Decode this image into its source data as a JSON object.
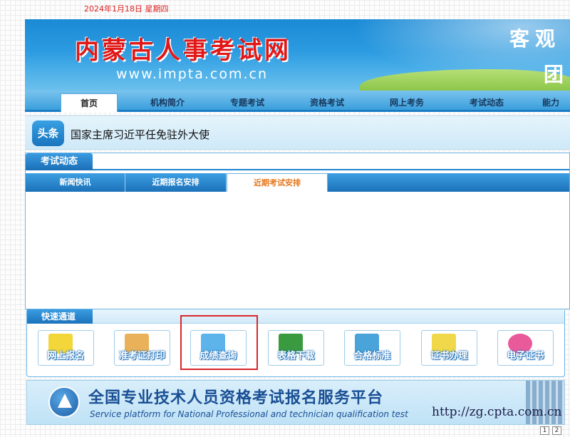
{
  "date": "2024年1月18日 星期四",
  "banner": {
    "title": "内蒙古人事考试网",
    "url": "www.impta.com.cn",
    "slogan_line1": "客观",
    "slogan_line2": "团"
  },
  "nav": {
    "items": [
      {
        "label": "首页",
        "active": true
      },
      {
        "label": "机构简介"
      },
      {
        "label": "专题考试"
      },
      {
        "label": "资格考试"
      },
      {
        "label": "网上考务"
      },
      {
        "label": "考试动态"
      },
      {
        "label": "能力"
      }
    ]
  },
  "headline": {
    "badge": "头条",
    "text": "国家主席习近平任免驻外大使"
  },
  "exam_news": {
    "title": "考试动态",
    "tabs": [
      {
        "label": "新闻快讯"
      },
      {
        "label": "近期报名安排"
      },
      {
        "label": "近期考试安排",
        "active": true
      }
    ]
  },
  "quick_access": {
    "title": "快速通道",
    "buttons": [
      {
        "label": "网上报名",
        "icon": "monitor-icon",
        "color": "#f2d63a"
      },
      {
        "label": "准考证打印",
        "icon": "printer-icon",
        "color": "#e9b25a"
      },
      {
        "label": "成绩查询",
        "icon": "magnifier-card-icon",
        "color": "#5db4ea"
      },
      {
        "label": "表格下载",
        "icon": "excel-icon",
        "color": "#3a9a3f"
      },
      {
        "label": "合格标准",
        "icon": "bar-chart-icon",
        "color": "#4aa3d9"
      },
      {
        "label": "证书办理",
        "icon": "certificate-icon",
        "color": "#f0d84a"
      },
      {
        "label": "电子证书",
        "icon": "e-certificate-icon",
        "color": "#e85a9a"
      }
    ]
  },
  "platform": {
    "title": "全国专业技术人员资格考试报名服务平台",
    "subtitle": "Service platform for National Professional and technician qualification test",
    "url": "http://zg.cpta.com.cn"
  },
  "pager": [
    "1",
    "2"
  ]
}
